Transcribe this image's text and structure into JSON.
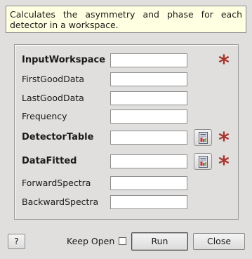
{
  "description": "Calculates the asymmetry and phase for each detector in a workspace.",
  "properties": [
    {
      "label": "InputWorkspace",
      "value": "",
      "bold": true,
      "required": true,
      "browse": false
    },
    {
      "label": "FirstGoodData",
      "value": "",
      "bold": false,
      "required": false,
      "browse": false
    },
    {
      "label": "LastGoodData",
      "value": "",
      "bold": false,
      "required": false,
      "browse": false
    },
    {
      "label": "Frequency",
      "value": "",
      "bold": false,
      "required": false,
      "browse": false
    },
    {
      "label": "DetectorTable",
      "value": "",
      "bold": true,
      "required": true,
      "browse": true
    },
    {
      "label": "DataFitted",
      "value": "",
      "bold": true,
      "required": true,
      "browse": true
    },
    {
      "label": "ForwardSpectra",
      "value": "",
      "bold": false,
      "required": false,
      "browse": false
    },
    {
      "label": "BackwardSpectra",
      "value": "",
      "bold": false,
      "required": false,
      "browse": false
    }
  ],
  "required_marker": "*",
  "buttons": {
    "help_label": "?",
    "keep_open_label": "Keep Open",
    "keep_open_checked": false,
    "run_label": "Run",
    "close_label": "Close"
  },
  "icons": {
    "browse": "workspace-browse-icon",
    "required": "required-asterisk"
  },
  "colors": {
    "background": "#e0dfde",
    "description_background": "#ffffe1",
    "required_star": "#a8362d"
  }
}
